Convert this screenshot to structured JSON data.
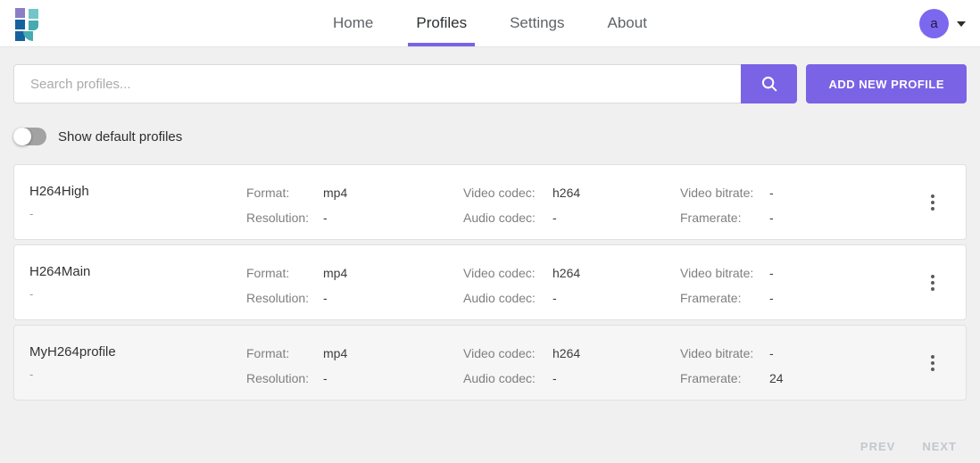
{
  "colors": {
    "accent": "#7b63e6",
    "avatar": "#7b68ee",
    "bodybg": "#f0f0f0",
    "cardborder": "#e0e0e0",
    "label": "#7f7f7f",
    "value": "#3d3d3d",
    "navgray": "#5f6368"
  },
  "header": {
    "nav_items": [
      {
        "label": "Home",
        "active": false
      },
      {
        "label": "Profiles",
        "active": true
      },
      {
        "label": "Settings",
        "active": false
      },
      {
        "label": "About",
        "active": false
      }
    ],
    "avatar_initial": "a"
  },
  "search": {
    "placeholder": "Search profiles...",
    "add_button_label": "ADD NEW PROFILE"
  },
  "filters": {
    "show_default_label": "Show default profiles",
    "show_default_enabled": false
  },
  "field_labels": {
    "format": "Format:",
    "resolution": "Resolution:",
    "video_codec": "Video codec:",
    "audio_codec": "Audio codec:",
    "video_bitrate": "Video bitrate:",
    "framerate": "Framerate:"
  },
  "profiles": [
    {
      "name": "H264High",
      "description": "-",
      "format": "mp4",
      "resolution": "-",
      "video_codec": "h264",
      "audio_codec": "-",
      "video_bitrate": "-",
      "framerate": "-"
    },
    {
      "name": "H264Main",
      "description": "-",
      "format": "mp4",
      "resolution": "-",
      "video_codec": "h264",
      "audio_codec": "-",
      "video_bitrate": "-",
      "framerate": "-"
    },
    {
      "name": "MyH264profile",
      "description": "-",
      "format": "mp4",
      "resolution": "-",
      "video_codec": "h264",
      "audio_codec": "-",
      "video_bitrate": "-",
      "framerate": "24"
    }
  ],
  "pagination": {
    "prev_label": "PREV",
    "next_label": "NEXT"
  }
}
